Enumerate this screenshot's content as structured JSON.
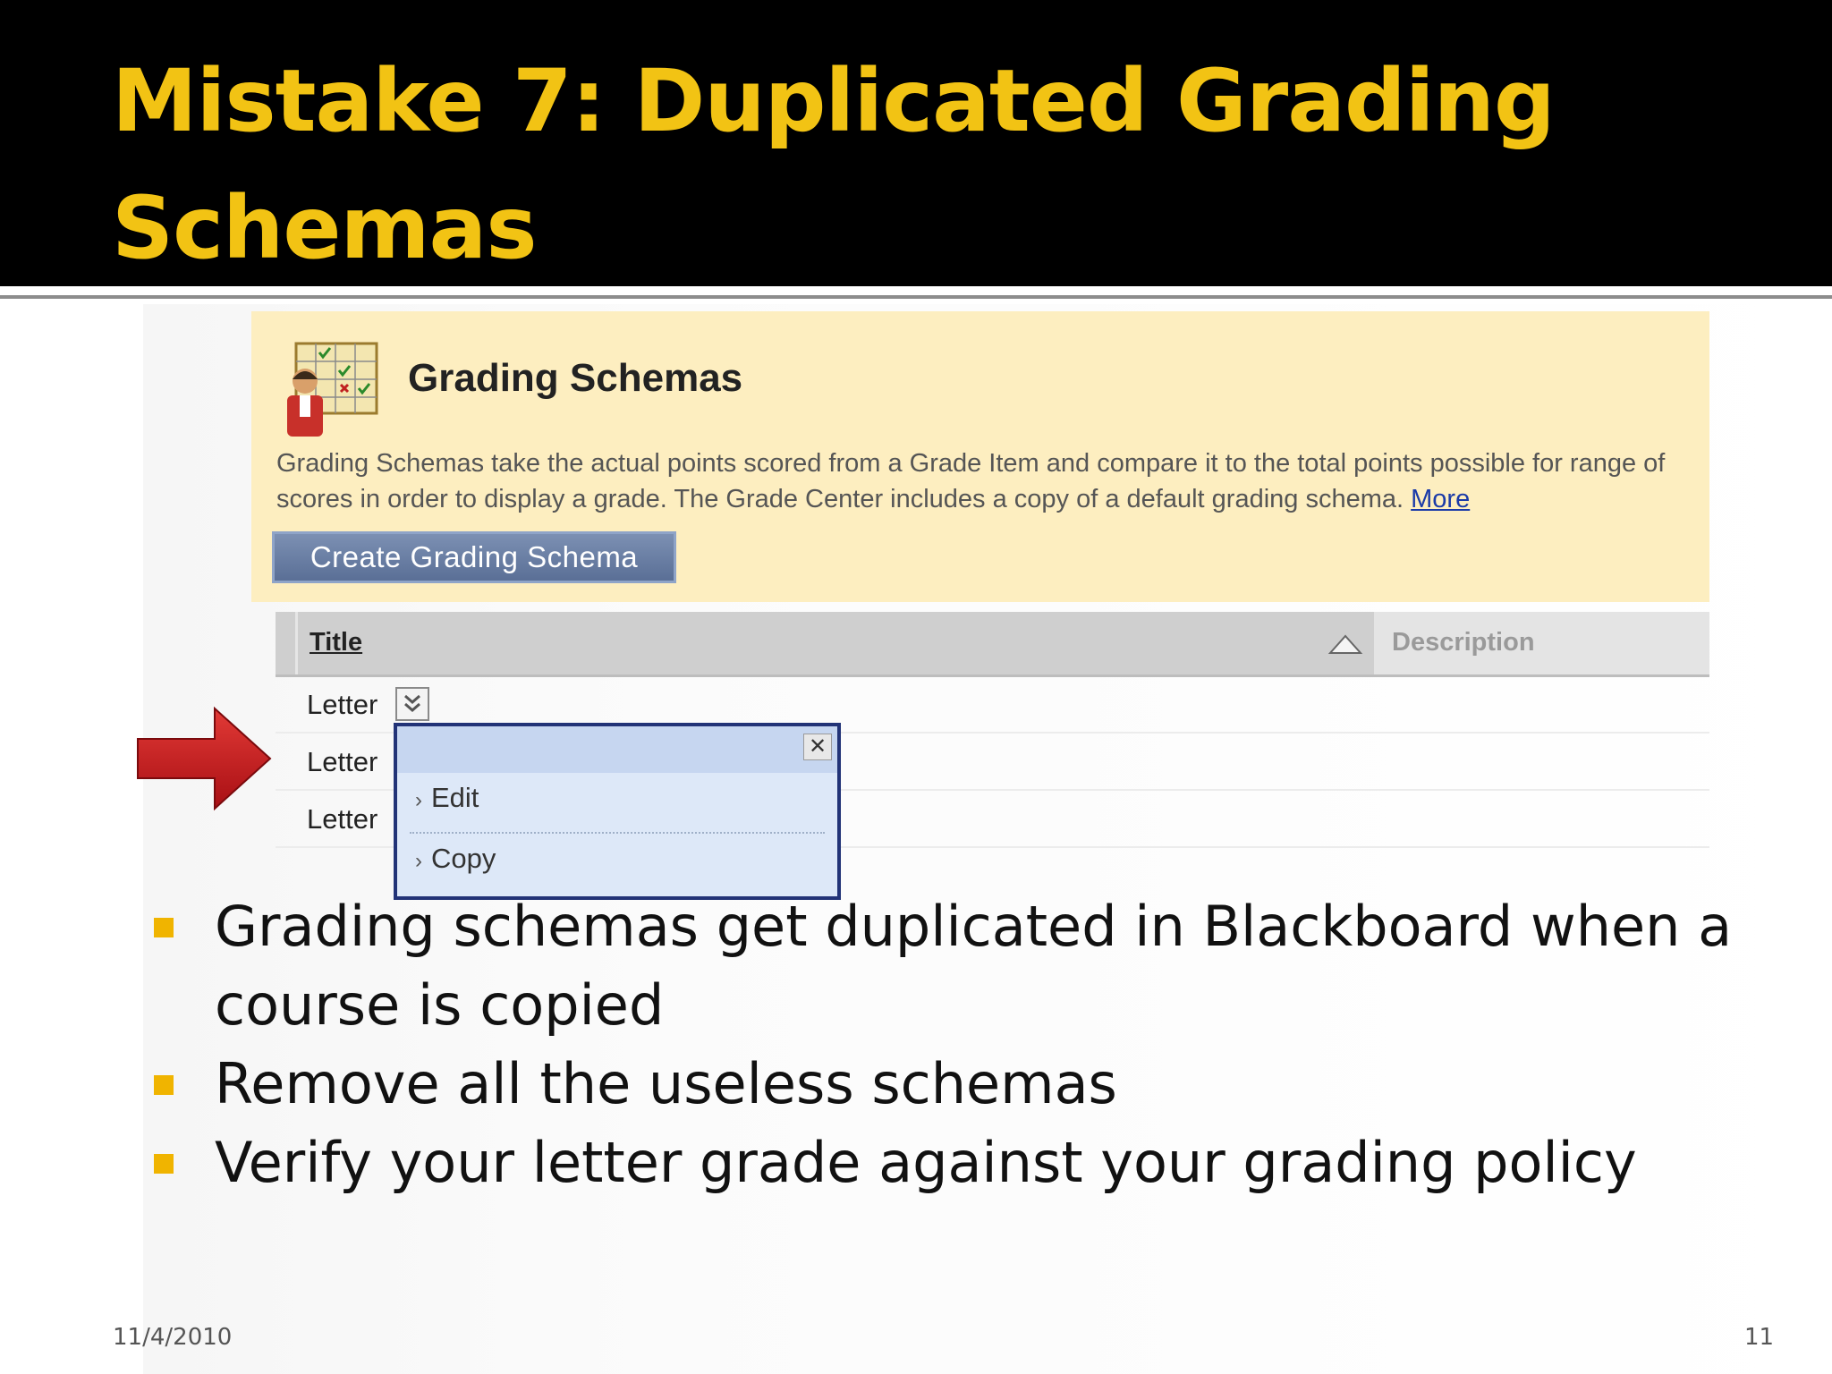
{
  "slide": {
    "title": "Mistake 7: Duplicated Grading Schemas",
    "date": "11/4/2010",
    "page_number": "11"
  },
  "screenshot": {
    "heading": "Grading Schemas",
    "description": "Grading Schemas take the actual points scored from a Grade Item and compare it to the total points possible for range of scores in order to display a grade. The Grade Center includes a copy of a default grading schema.",
    "more_link": "More",
    "create_button": "Create Grading Schema",
    "table": {
      "columns": [
        "Title",
        "Description"
      ],
      "rows": [
        "Letter",
        "Letter",
        "Letter"
      ]
    },
    "context_menu": {
      "items": [
        "Edit",
        "Copy"
      ],
      "close_symbol": "✕"
    }
  },
  "bullets": [
    "Grading schemas get duplicated in Blackboard when a course is copied",
    "Remove all the useless schemas",
    "Verify your letter grade against your grading policy"
  ],
  "colors": {
    "title": "#f2c314",
    "title_bar": "#000000",
    "bullet": "#f0b400",
    "panel": "#fdeec0",
    "button": "#5a6f96",
    "arrow": "#c8161b"
  },
  "icons": {
    "schema": "grading-schema-icon",
    "sort": "sort-ascending-icon",
    "chevron": "chevron-down-icon",
    "close": "close-icon",
    "arrow": "red-arrow-icon"
  }
}
